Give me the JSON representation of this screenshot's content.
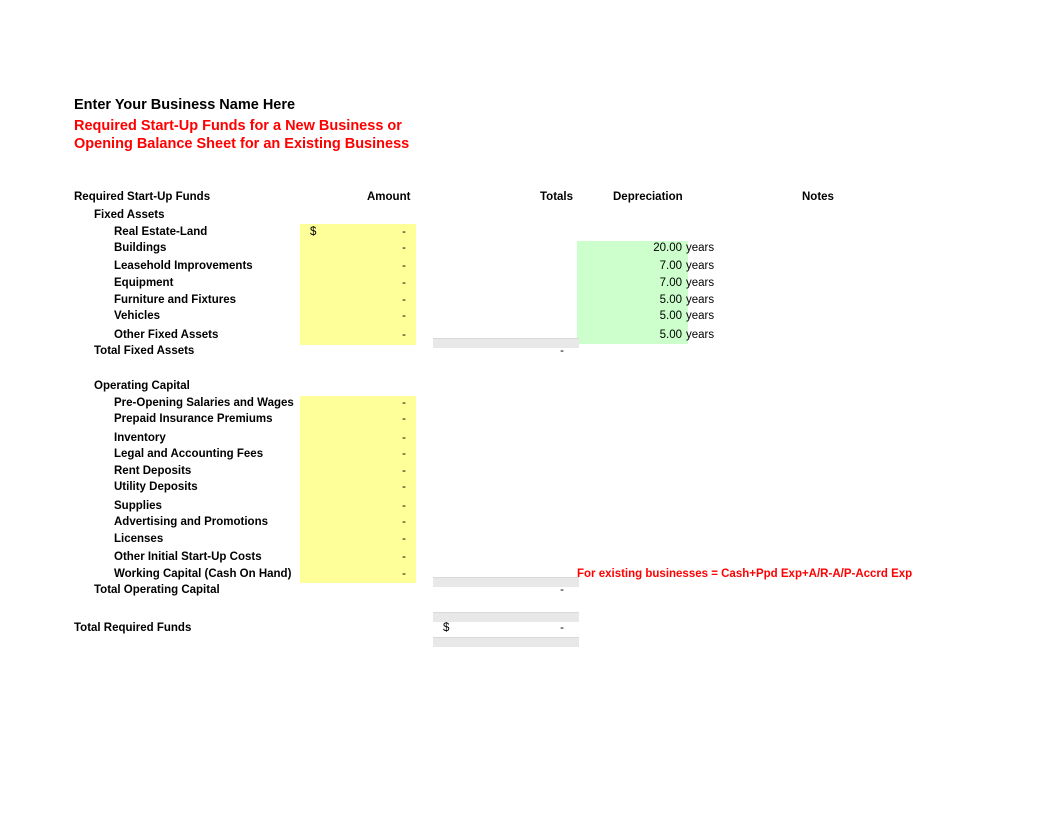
{
  "titles": {
    "business_name": "Enter Your Business Name Here",
    "subtitle_line1": "Required Start-Up Funds for a New Business or",
    "subtitle_line2": "Opening Balance Sheet for an Existing Business"
  },
  "colors": {
    "title_accent": "#ff0000",
    "input_fill": "#ffff99",
    "depreciation_fill": "#ccffcc",
    "total_fill": "#e8e8e8"
  },
  "columns": {
    "rows": "Required Start-Up Funds",
    "amount": "Amount",
    "totals": "Totals",
    "depreciation": "Depreciation",
    "notes": "Notes"
  },
  "sections": [
    {
      "heading": "Fixed Assets",
      "rows": [
        {
          "label": "Real Estate-Land",
          "amount": "-",
          "currency": "$",
          "dep_value": "",
          "dep_unit": ""
        },
        {
          "label": "Buildings",
          "amount": "-",
          "currency": "",
          "dep_value": "20.00",
          "dep_unit": "years"
        },
        {
          "label": "Leasehold Improvements",
          "amount": "-",
          "currency": "",
          "dep_value": "7.00",
          "dep_unit": "years"
        },
        {
          "label": "Equipment",
          "amount": "-",
          "currency": "",
          "dep_value": "7.00",
          "dep_unit": "years"
        },
        {
          "label": "Furniture and Fixtures",
          "amount": "-",
          "currency": "",
          "dep_value": "5.00",
          "dep_unit": "years"
        },
        {
          "label": "Vehicles",
          "amount": "-",
          "currency": "",
          "dep_value": "5.00",
          "dep_unit": "years"
        },
        {
          "label": "Other Fixed Assets",
          "amount": "-",
          "currency": "",
          "dep_value": "5.00",
          "dep_unit": "years"
        }
      ],
      "total_label": "Total Fixed Assets",
      "total_value": "-"
    },
    {
      "heading": "Operating Capital",
      "rows": [
        {
          "label": "Pre-Opening Salaries and Wages",
          "amount": "-",
          "currency": "",
          "dep_value": "",
          "dep_unit": ""
        },
        {
          "label": "Prepaid Insurance Premiums",
          "amount": "-",
          "currency": "",
          "dep_value": "",
          "dep_unit": ""
        },
        {
          "label": "Inventory",
          "amount": "-",
          "currency": "",
          "dep_value": "",
          "dep_unit": ""
        },
        {
          "label": "Legal and Accounting Fees",
          "amount": "-",
          "currency": "",
          "dep_value": "",
          "dep_unit": ""
        },
        {
          "label": "Rent Deposits",
          "amount": "-",
          "currency": "",
          "dep_value": "",
          "dep_unit": ""
        },
        {
          "label": "Utility Deposits",
          "amount": "-",
          "currency": "",
          "dep_value": "",
          "dep_unit": ""
        },
        {
          "label": "Supplies",
          "amount": "-",
          "currency": "",
          "dep_value": "",
          "dep_unit": ""
        },
        {
          "label": "Advertising and Promotions",
          "amount": "-",
          "currency": "",
          "dep_value": "",
          "dep_unit": ""
        },
        {
          "label": "Licenses",
          "amount": "-",
          "currency": "",
          "dep_value": "",
          "dep_unit": ""
        },
        {
          "label": "Other Initial Start-Up Costs",
          "amount": "-",
          "currency": "",
          "dep_value": "",
          "dep_unit": ""
        },
        {
          "label": "Working Capital (Cash On Hand)",
          "amount": "-",
          "currency": "",
          "dep_value": "",
          "dep_unit": ""
        }
      ],
      "total_label": "Total Operating Capital",
      "total_value": "-"
    }
  ],
  "grand_total": {
    "label": "Total Required Funds",
    "currency": "$",
    "value": "-"
  },
  "notes": {
    "existing_business": "For existing businesses = Cash+Ppd Exp+A/R-A/P-Accrd Exp"
  }
}
